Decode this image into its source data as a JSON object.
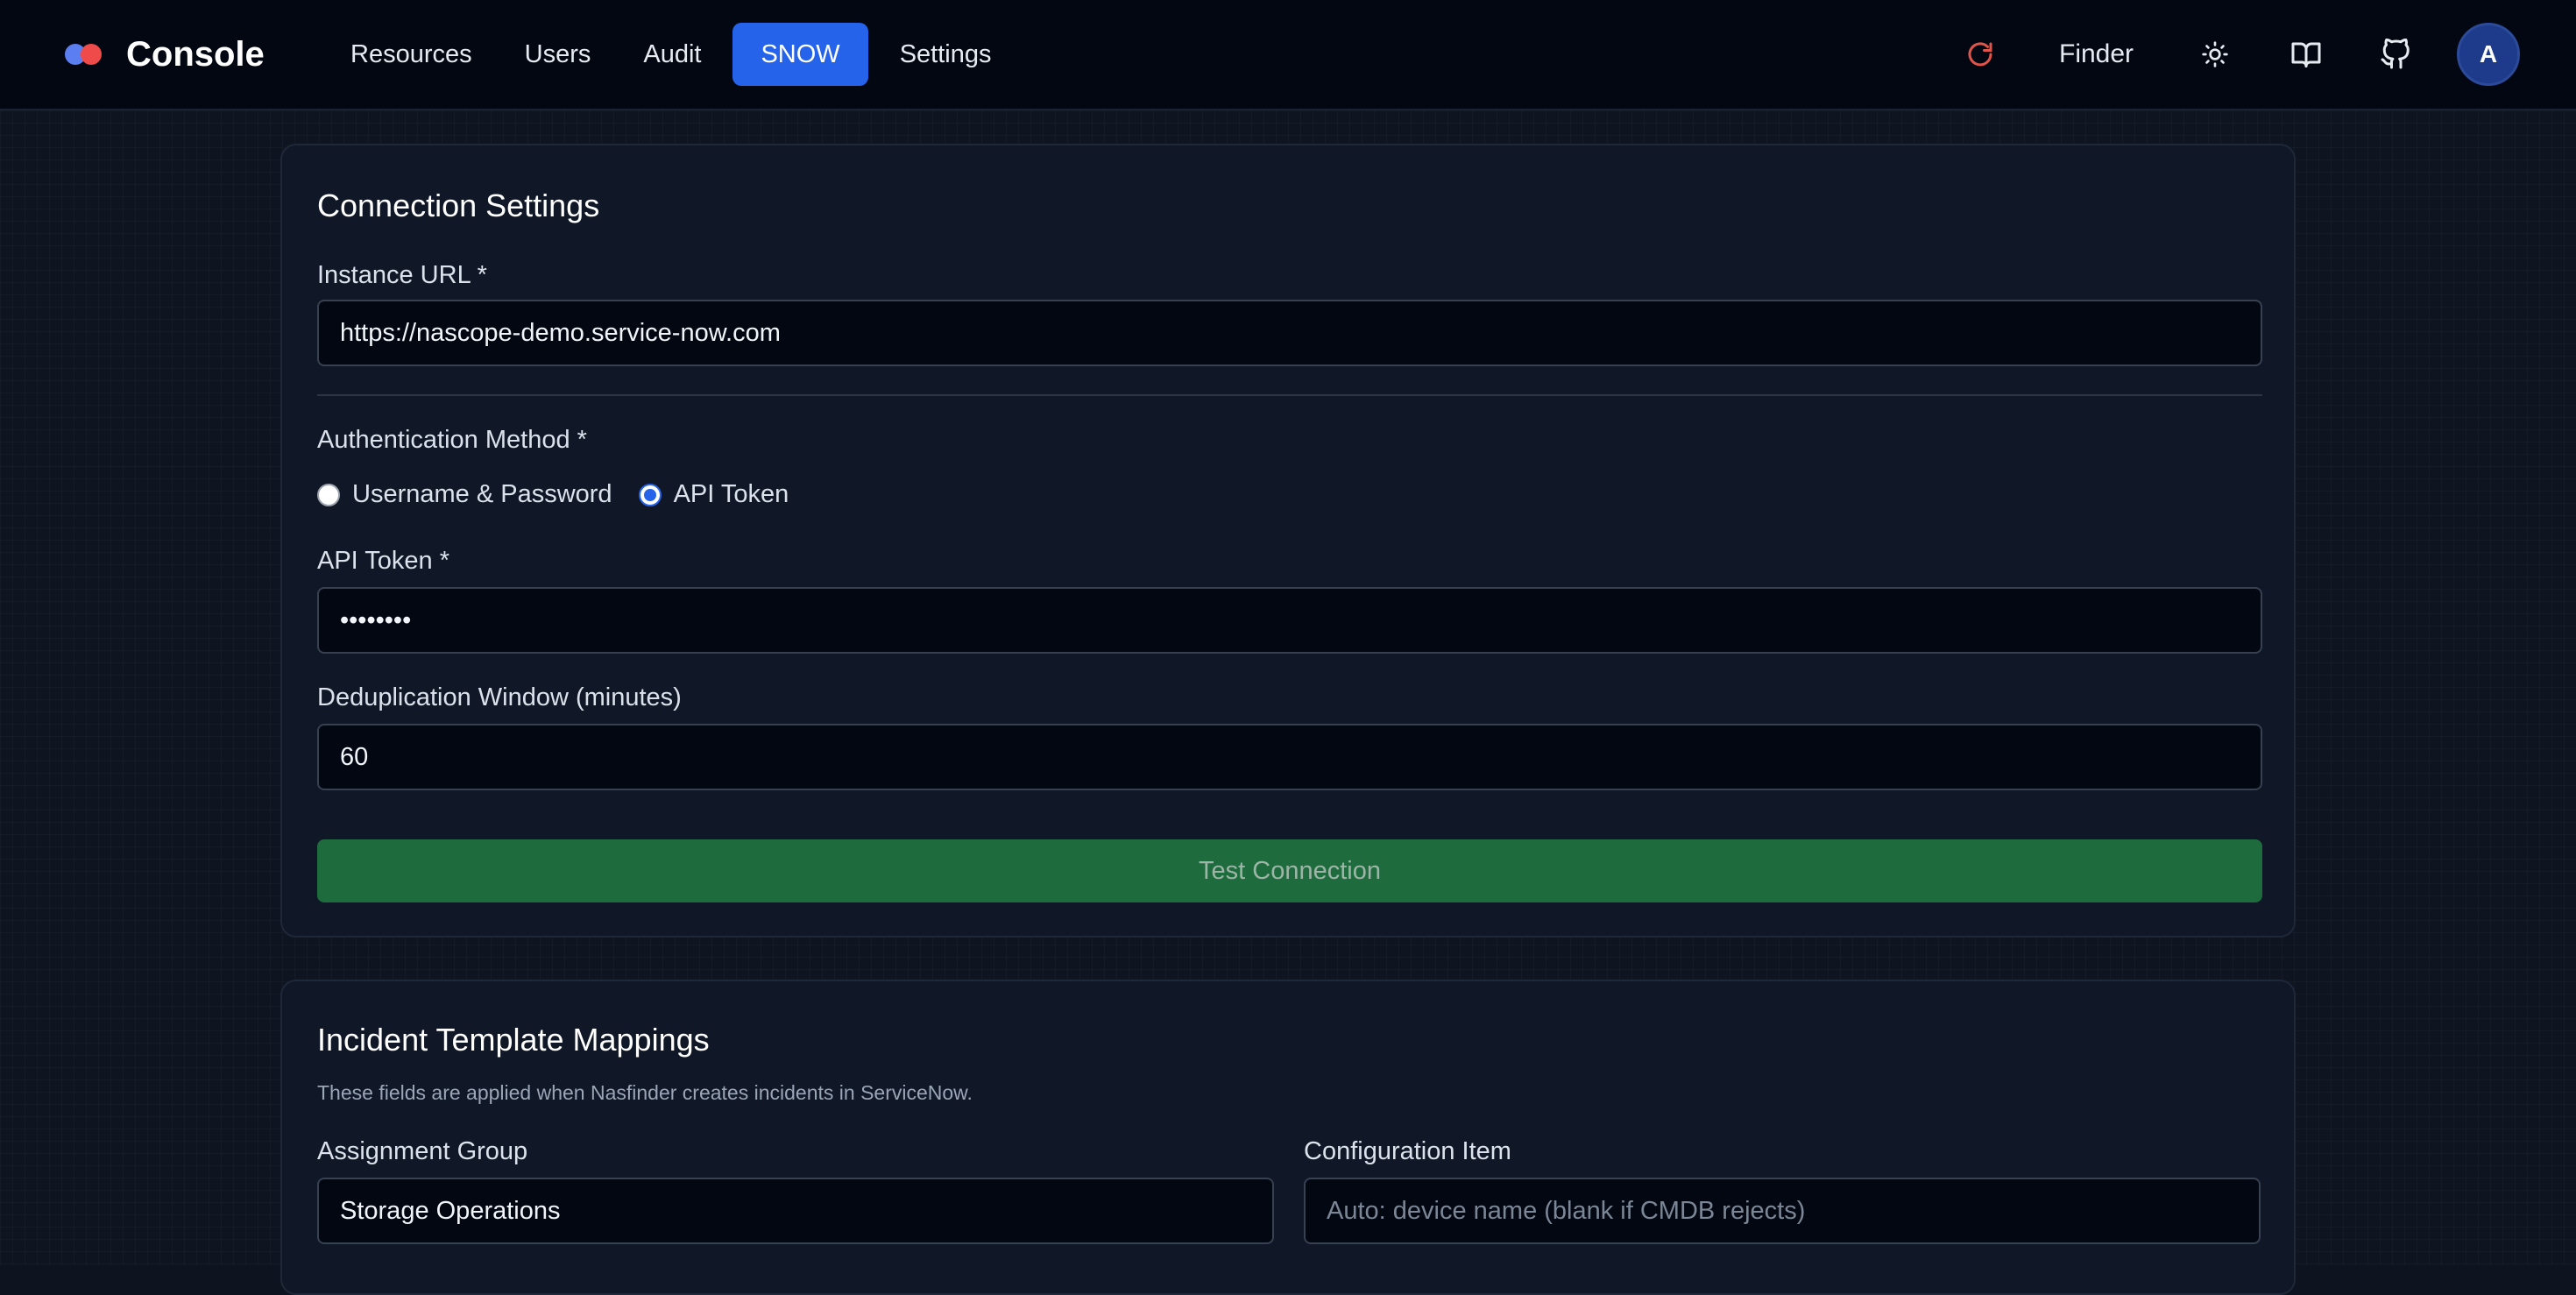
{
  "header": {
    "brand": "Console",
    "nav": [
      {
        "label": "Resources",
        "active": false
      },
      {
        "label": "Users",
        "active": false
      },
      {
        "label": "Audit",
        "active": false
      },
      {
        "label": "SNOW",
        "active": true
      },
      {
        "label": "Settings",
        "active": false
      }
    ],
    "finder_label": "Finder",
    "avatar_initial": "A",
    "icons": [
      "refresh-icon",
      "sun-icon",
      "book-icon",
      "github-icon"
    ]
  },
  "connection": {
    "title": "Connection Settings",
    "instance_url_label": "Instance URL *",
    "instance_url_value": "https://nascope-demo.service-now.com",
    "auth_label": "Authentication Method *",
    "auth_options": [
      "Username & Password",
      "API Token"
    ],
    "auth_selected": "API Token",
    "token_label": "API Token *",
    "token_value": "••••••••",
    "dedup_label": "Deduplication Window (minutes)",
    "dedup_value": "60",
    "test_button": "Test Connection"
  },
  "mappings": {
    "title": "Incident Template Mappings",
    "helper": "These fields are applied when Nasfinder creates incidents in ServiceNow.",
    "assignment_group_label": "Assignment Group",
    "assignment_group_value": "Storage Operations",
    "config_item_label": "Configuration Item",
    "config_item_placeholder": "Auto: device name (blank if CMDB rejects)"
  },
  "colors": {
    "accent": "#2563eb",
    "success_button": "#1e6b3e",
    "header_bg": "#030712",
    "card_bg": "#101827"
  }
}
